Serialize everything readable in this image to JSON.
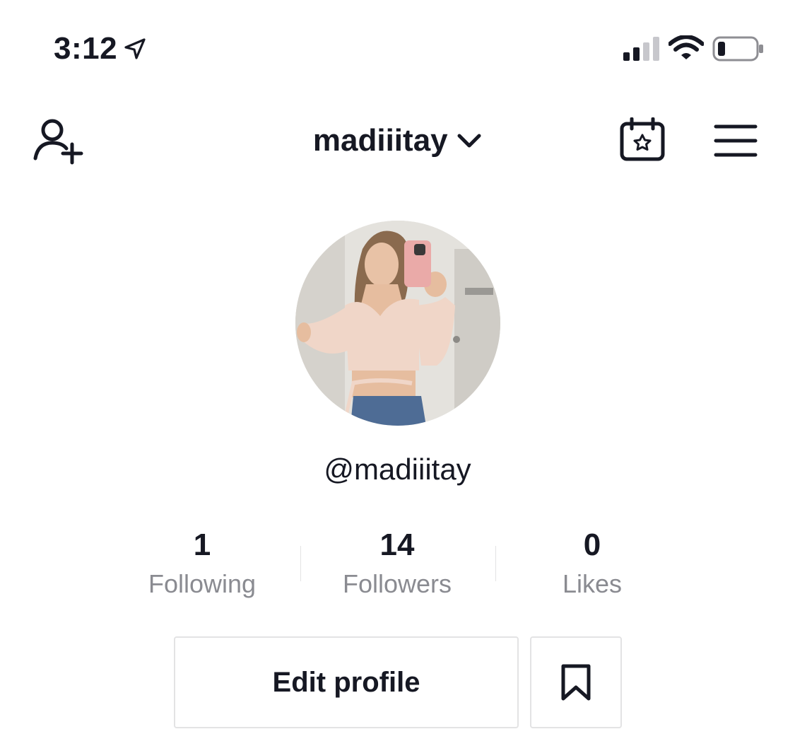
{
  "status_bar": {
    "time": "3:12",
    "icons": [
      "location-arrow-icon",
      "cellular-signal-icon",
      "wifi-icon",
      "battery-icon"
    ]
  },
  "header": {
    "username": "madiiitay",
    "icons": [
      "add-user-icon",
      "chevron-down-icon",
      "calendar-star-icon",
      "hamburger-menu-icon"
    ]
  },
  "profile": {
    "handle": "@madiiitay"
  },
  "stats": [
    {
      "value": "1",
      "label": "Following"
    },
    {
      "value": "14",
      "label": "Followers"
    },
    {
      "value": "0",
      "label": "Likes"
    }
  ],
  "actions": {
    "edit_profile_label": "Edit profile",
    "bookmark_icon": "bookmark-icon"
  },
  "colors": {
    "text": "#161823",
    "secondary_text": "#8a8b91",
    "border": "#e3e3e4",
    "background": "#ffffff"
  }
}
